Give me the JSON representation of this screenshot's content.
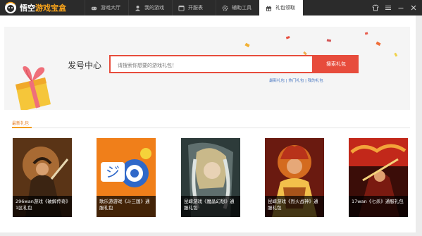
{
  "app": {
    "logo_text_1": "悟空",
    "logo_text_2": "游戏宝盒"
  },
  "nav": {
    "tabs": [
      {
        "label": "游戏大厅",
        "icon": "controller-icon",
        "active": false
      },
      {
        "label": "我的游戏",
        "icon": "user-icon",
        "active": false
      },
      {
        "label": "开服表",
        "icon": "calendar-icon",
        "active": false
      },
      {
        "label": "辅助工具",
        "icon": "gear-icon",
        "active": false
      },
      {
        "label": "礼包领取",
        "icon": "gift-icon",
        "active": true
      }
    ]
  },
  "window_controls": [
    "skin-icon",
    "menu-icon",
    "minimize-icon",
    "close-icon"
  ],
  "banner": {
    "title": "发号中心",
    "search_placeholder": "请搜索你想要的游戏礼包！",
    "search_button": "搜索礼包",
    "links": "最新礼包  |  热门礼包  |  我的礼包"
  },
  "section": {
    "title": "最新礼包"
  },
  "cards": [
    {
      "caption": "296wan游戏《破解传奇》1区礼包",
      "palette": [
        "#7a4a1e",
        "#c27b3c",
        "#3b2412"
      ]
    },
    {
      "caption": "歌乐游游戏《斗三国》通服礼包",
      "palette": [
        "#f07f1a",
        "#2f68c9",
        "#f5d23a"
      ]
    },
    {
      "caption": "昆嵘游戏《魔晶幻想》通服礼包",
      "palette": [
        "#2d3b3a",
        "#8ea2a5",
        "#c9b98a"
      ]
    },
    {
      "caption": "昆嵘游戏《烈火战神》通服礼包",
      "palette": [
        "#6a1a10",
        "#d46b1f",
        "#f2c04b"
      ]
    },
    {
      "caption": "17wan《七杀》通服礼包",
      "palette": [
        "#3b0d08",
        "#c2281a",
        "#f3a43a"
      ]
    }
  ],
  "colors": {
    "titlebar": "#2b2b2b",
    "accent_red": "#e74c3c",
    "accent_orange": "#f39c12",
    "banner_bg": "#f5f5f5"
  }
}
